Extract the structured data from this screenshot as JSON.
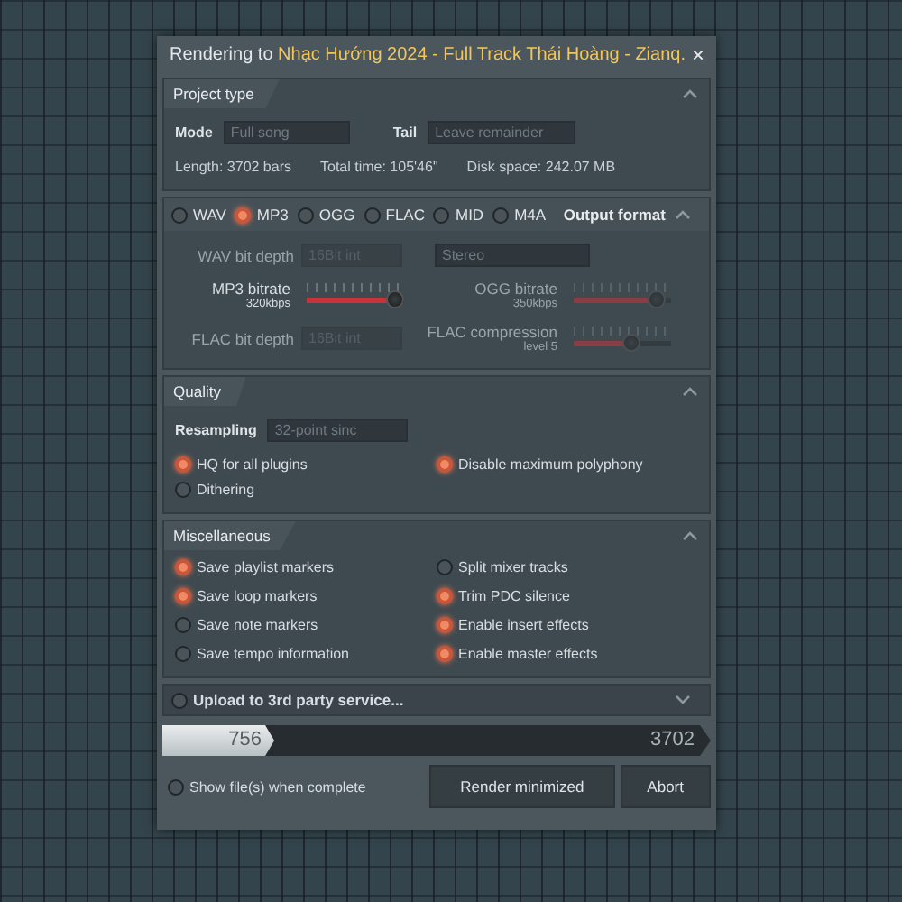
{
  "dialog": {
    "title_prefix": "Rendering to",
    "title_file": "Nhạc Hướng 2024 - Full Track Thái Hoàng - Zianq."
  },
  "project_type": {
    "title": "Project type",
    "mode_label": "Mode",
    "mode_value": "Full song",
    "tail_label": "Tail",
    "tail_value": "Leave remainder",
    "length": "Length: 3702 bars",
    "total_time": "Total time: 105'46\"",
    "disk_space": "Disk space: 242.07 MB"
  },
  "output_format": {
    "title": "Output format",
    "formats": [
      {
        "label": "WAV",
        "selected": false
      },
      {
        "label": "MP3",
        "selected": true
      },
      {
        "label": "OGG",
        "selected": false
      },
      {
        "label": "FLAC",
        "selected": false
      },
      {
        "label": "MID",
        "selected": false
      },
      {
        "label": "M4A",
        "selected": false
      }
    ],
    "wav_bit_depth": {
      "label": "WAV bit depth",
      "value": "16Bit int",
      "disabled": true
    },
    "channels": {
      "value": "Stereo",
      "disabled": false
    },
    "mp3_bitrate": {
      "label": "MP3 bitrate",
      "reading": "320kbps",
      "level": 0.9,
      "disabled": false
    },
    "ogg_bitrate": {
      "label": "OGG bitrate",
      "reading": "350kbps",
      "level": 0.85,
      "disabled": true
    },
    "flac_bit_depth": {
      "label": "FLAC bit depth",
      "value": "16Bit int",
      "disabled": true
    },
    "flac_compression": {
      "label": "FLAC compression",
      "reading": "level 5",
      "level": 0.6,
      "disabled": true
    }
  },
  "quality": {
    "title": "Quality",
    "resampling_label": "Resampling",
    "resampling_value": "32-point sinc",
    "options": [
      {
        "label": "HQ for all plugins",
        "checked": true
      },
      {
        "label": "Disable maximum polyphony",
        "checked": true
      },
      {
        "label": "Dithering",
        "checked": false
      }
    ]
  },
  "miscellaneous": {
    "title": "Miscellaneous",
    "options": [
      {
        "label": "Save playlist markers",
        "checked": true
      },
      {
        "label": "Split mixer tracks",
        "checked": false
      },
      {
        "label": "Save loop markers",
        "checked": true
      },
      {
        "label": "Trim PDC silence",
        "checked": true
      },
      {
        "label": "Save note markers",
        "checked": false
      },
      {
        "label": "Enable insert effects",
        "checked": true
      },
      {
        "label": "Save tempo information",
        "checked": false
      },
      {
        "label": "Enable master effects",
        "checked": true
      }
    ]
  },
  "upload": {
    "label": "Upload to 3rd party service...",
    "checked": false
  },
  "progress": {
    "current": "756",
    "total": "3702",
    "level": 0.204
  },
  "show_files": {
    "label": "Show file(s) when complete",
    "checked": false
  },
  "buttons": [
    "Render minimized",
    "Abort"
  ]
}
